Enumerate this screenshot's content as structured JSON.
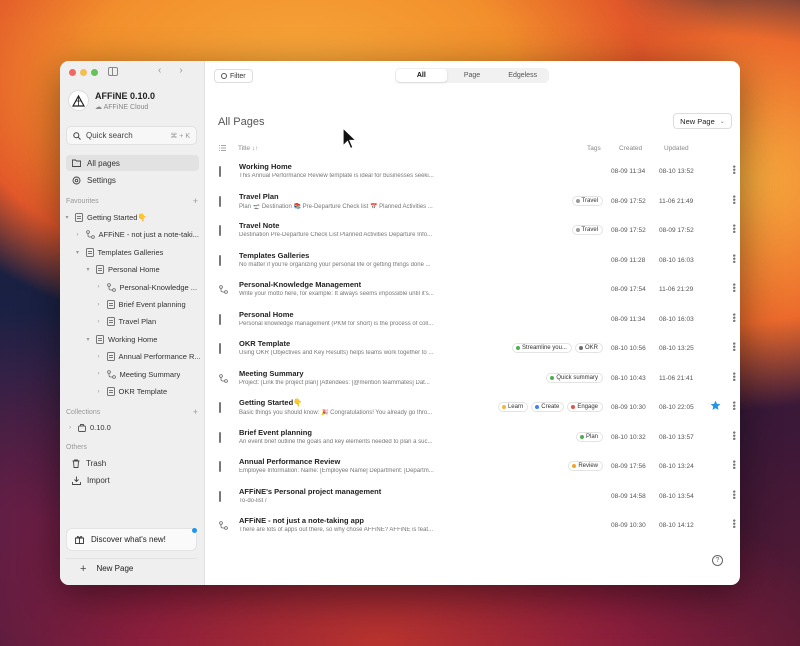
{
  "sidebar": {
    "workspace_name": "AFFiNE 0.10.0",
    "workspace_sub": "AFFiNE Cloud",
    "quick_search": "Quick search",
    "quick_search_shortcut": "⌘ + K",
    "all_pages": "All pages",
    "settings": "Settings",
    "favourites_label": "Favourites",
    "tree": [
      {
        "label": "Getting Started👇",
        "kind": "doc",
        "caret": "▾",
        "indent": 0
      },
      {
        "label": "AFFiNE - not just a note-taki...",
        "kind": "edgeless",
        "caret": "›",
        "indent": 1
      },
      {
        "label": "Templates Galleries",
        "kind": "doc",
        "caret": "▾",
        "indent": 1
      },
      {
        "label": "Personal Home",
        "kind": "doc",
        "caret": "▾",
        "indent": 2
      },
      {
        "label": "Personal-Knowledge ...",
        "kind": "edgeless",
        "caret": "›",
        "indent": 3
      },
      {
        "label": "Brief Event planning",
        "kind": "doc",
        "caret": "›",
        "indent": 3
      },
      {
        "label": "Travel Plan",
        "kind": "doc",
        "caret": "›",
        "indent": 3
      },
      {
        "label": "Working Home",
        "kind": "doc",
        "caret": "▾",
        "indent": 2
      },
      {
        "label": "Annual Performance R...",
        "kind": "doc",
        "caret": "›",
        "indent": 3
      },
      {
        "label": "Meeting Summary",
        "kind": "edgeless",
        "caret": "›",
        "indent": 3
      },
      {
        "label": "OKR Template",
        "kind": "doc",
        "caret": "›",
        "indent": 3
      }
    ],
    "collections_label": "Collections",
    "collection_item": "0.10.0",
    "others_label": "Others",
    "trash": "Trash",
    "import": "Import",
    "discover": "Discover what's new!",
    "new_page": "New Page"
  },
  "toolbar": {
    "filter": "Filter",
    "segments": [
      "All",
      "Page",
      "Edgeless"
    ],
    "active_segment": "All"
  },
  "main": {
    "title": "All Pages",
    "new_page_button": "New Page",
    "columns": {
      "title": "Title",
      "tags": "Tags",
      "created": "Created",
      "updated": "Updated"
    },
    "rows": [
      {
        "title": "Working Home",
        "preview": "This Annual Performance Review template is ideal for businesses seeki...",
        "kind": "doc",
        "tags": [],
        "created": "08-09 11:34",
        "updated": "08-10 13:52",
        "starred": false
      },
      {
        "title": "Travel Plan",
        "preview": "Plan 🛫 Destination 📚 Pre-Departure Check list 📅 Planned Activities ...",
        "kind": "doc",
        "tags": [
          {
            "name": "Travel",
            "color": "#9a9a9a"
          }
        ],
        "created": "08-09 17:52",
        "updated": "11-06 21:49",
        "starred": false
      },
      {
        "title": "Travel Note",
        "preview": "Destination Pre-Departure Check List Planned Activities Departure Info...",
        "kind": "doc",
        "tags": [
          {
            "name": "Travel",
            "color": "#9a9a9a"
          }
        ],
        "created": "08-09 17:52",
        "updated": "08-09 17:52",
        "starred": false
      },
      {
        "title": "Templates Galleries",
        "preview": "No matter if you're organizing your personal life or getting things done ...",
        "kind": "doc",
        "tags": [],
        "created": "08-09 11:28",
        "updated": "08-10 16:03",
        "starred": false
      },
      {
        "title": "Personal-Knowledge Management",
        "preview": "Write your motto here, for example: It always seems impossible until it's...",
        "kind": "edgeless",
        "tags": [],
        "created": "08-09 17:54",
        "updated": "11-06 21:29",
        "starred": false
      },
      {
        "title": "Personal Home",
        "preview": "Personal knowledge management (PKM for short) is the process of coll...",
        "kind": "doc",
        "tags": [],
        "created": "08-09 11:34",
        "updated": "08-10 16:03",
        "starred": false
      },
      {
        "title": "OKR Template",
        "preview": "Using OKR (Objectives and Key Results) helps teams work together to ...",
        "kind": "doc",
        "tags": [
          {
            "name": "Streamline you...",
            "color": "#4caf50"
          },
          {
            "name": "OKR",
            "color": "#6b6b6b"
          }
        ],
        "created": "08-10 10:56",
        "updated": "08-10 13:25",
        "starred": false
      },
      {
        "title": "Meeting Summary",
        "preview": "Project: [Link the project plan] [Attendees: [@mention teammates] Dat...",
        "kind": "edgeless",
        "tags": [
          {
            "name": "Quick summary",
            "color": "#4caf50"
          }
        ],
        "created": "08-10 10:43",
        "updated": "11-06 21:41",
        "starred": false
      },
      {
        "title": "Getting Started👇",
        "preview": "Basic things you should know: 🎉 Congratulations! You already go thro...",
        "kind": "doc",
        "tags": [
          {
            "name": "Learn",
            "color": "#f5b73b"
          },
          {
            "name": "Create",
            "color": "#3b82f6"
          },
          {
            "name": "Engage",
            "color": "#e0564b"
          }
        ],
        "created": "08-09 10:30",
        "updated": "08-10 22:05",
        "starred": true
      },
      {
        "title": "Brief Event planning",
        "preview": "An event brief outline the goals and key elements needed to plan a suc...",
        "kind": "doc",
        "tags": [
          {
            "name": "Plan",
            "color": "#4caf50"
          }
        ],
        "created": "08-10 10:32",
        "updated": "08-10 13:57",
        "starred": false
      },
      {
        "title": "Annual Performance Review",
        "preview": "Employee Information: Name: [Employee Name] Department: [Departm...",
        "kind": "doc",
        "tags": [
          {
            "name": "Review",
            "color": "#f5a623"
          }
        ],
        "created": "08-09 17:56",
        "updated": "08-10 13:24",
        "starred": false
      },
      {
        "title": "AFFiNE's Personal project management",
        "preview": "To-do-list /",
        "kind": "doc",
        "tags": [],
        "created": "08-09 14:58",
        "updated": "08-10 13:54",
        "starred": false
      },
      {
        "title": "AFFiNE - not just a note-taking app",
        "preview": "There are lots of apps out there, so why chose AFFiNE? AFFiNE is feat...",
        "kind": "edgeless",
        "tags": [],
        "created": "08-09 10:30",
        "updated": "08-10 14:12",
        "starred": false
      }
    ]
  },
  "colors": {
    "accent": "#1e96eb",
    "star": "#1e96eb"
  },
  "help": "?"
}
